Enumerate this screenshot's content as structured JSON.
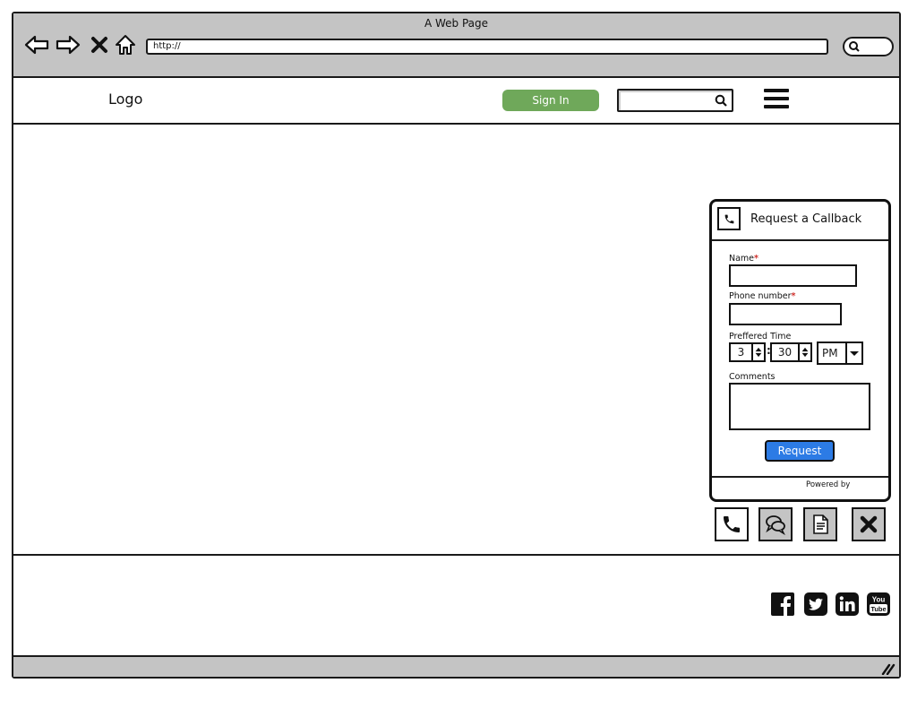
{
  "browser": {
    "window_title": "A Web Page",
    "url": "http://"
  },
  "header": {
    "logo_text": "Logo",
    "signin_label": "Sign In",
    "search_value": "",
    "accent_color": "#6fa85a"
  },
  "callback_widget": {
    "title": "Request a Callback",
    "name_label": "Name",
    "phone_label": "Phone number",
    "required_mark": "*",
    "time_label": "Preffered Time",
    "hour": "3",
    "minute": "30",
    "ampm": "PM",
    "comments_label": "Comments",
    "request_label": "Request",
    "powered_by": "Powered by",
    "button_color": "#2c7be5"
  },
  "toolbar": {
    "icons": [
      "phone-icon",
      "chat-icon",
      "document-icon",
      "close-icon"
    ]
  },
  "footer": {
    "social_icons": [
      "facebook-icon",
      "twitter-icon",
      "linkedin-icon",
      "youtube-icon"
    ]
  }
}
